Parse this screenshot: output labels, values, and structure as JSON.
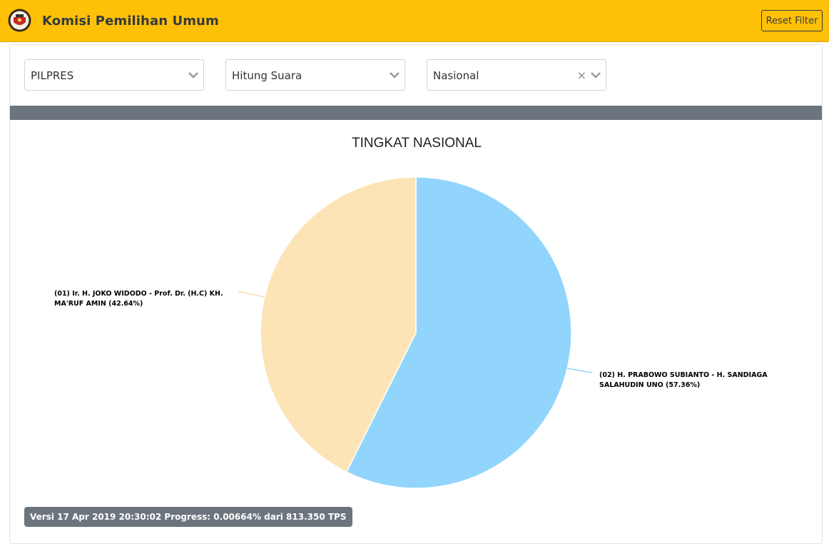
{
  "navbar": {
    "brand": "Komisi Pemilihan Umum",
    "logo_icon": "kpu-emblem-icon",
    "reset_label": "Reset Filter",
    "background": "#ffc107"
  },
  "filters": [
    {
      "value": "PILPRES",
      "clearable": false
    },
    {
      "value": "Hitung Suara",
      "clearable": false
    },
    {
      "value": "Nasional",
      "clearable": true,
      "clear_glyph": "×"
    }
  ],
  "chart_data": {
    "type": "pie",
    "title": "TINGKAT NASIONAL",
    "slices": [
      {
        "label_lines": [
          "(02) H. PRABOWO SUBIANTO - H. SANDIAGA",
          "SALAHUDIN UNO (57.36%)"
        ],
        "value": 57.36,
        "color": "#91d5fd"
      },
      {
        "label_lines": [
          "(01) Ir. H. JOKO WIDODO - Prof. Dr. (H.C) KH.",
          "MA'RUF AMIN (42.64%)"
        ],
        "value": 42.64,
        "color": "#fde4b6"
      }
    ]
  },
  "footer": {
    "version_text": "Versi 17 Apr 2019 20:30:02 Progress: 0.00664% dari 813.350 TPS"
  }
}
